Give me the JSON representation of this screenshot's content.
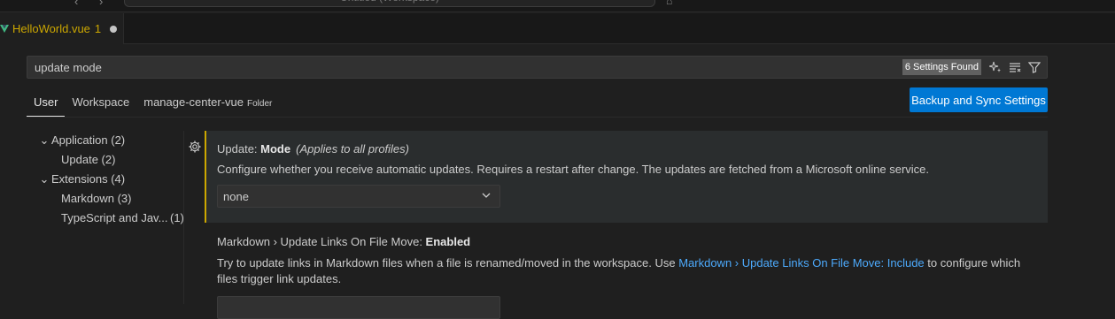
{
  "titlebar": {
    "nav_glyphs": "‹ ›",
    "command_center": "Untitled (Workspace)"
  },
  "tab": {
    "file_name": "HelloWorld.vue",
    "problem_count": "1",
    "icon": "vue-icon",
    "dirty": true
  },
  "search": {
    "query": "update mode",
    "results_badge": "6 Settings Found",
    "icons": [
      "sparkle-filter-icon",
      "clear-list-icon",
      "filter-icon"
    ]
  },
  "scope_tabs": [
    {
      "label": "User",
      "active": true
    },
    {
      "label": "Workspace",
      "active": false
    },
    {
      "label": "manage-center-vue",
      "tag": "Folder",
      "active": false
    }
  ],
  "sync_button": {
    "label": "Backup and Sync Settings"
  },
  "toc": [
    {
      "label": "Application",
      "count": "(2)",
      "level": 0,
      "expanded": true
    },
    {
      "label": "Update",
      "count": "(2)",
      "level": 1
    },
    {
      "label": "Extensions",
      "count": "(4)",
      "level": 0,
      "expanded": true
    },
    {
      "label": "Markdown",
      "count": "(3)",
      "level": 1
    },
    {
      "label": "TypeScript and Jav...",
      "count": "(1)",
      "level": 1
    }
  ],
  "settings": [
    {
      "category": "Update: ",
      "name": "Mode",
      "scope_note": "(Applies to all profiles)",
      "description": "Configure whether you receive automatic updates. Requires a restart after change. The updates are fetched from a Microsoft online service.",
      "value": "none"
    },
    {
      "category": "Markdown › Update Links On File Move: ",
      "name": "Enabled",
      "description_before": "Try to update links in Markdown files when a file is renamed/moved in the workspace. Use ",
      "description_link": "Markdown › Update Links On File Move: Include",
      "description_after": " to configure which files trigger link updates."
    }
  ],
  "colors": {
    "background": "#1f1f1f",
    "accent": "#0078d4",
    "modified": "#cca700",
    "link": "#4daafc"
  }
}
